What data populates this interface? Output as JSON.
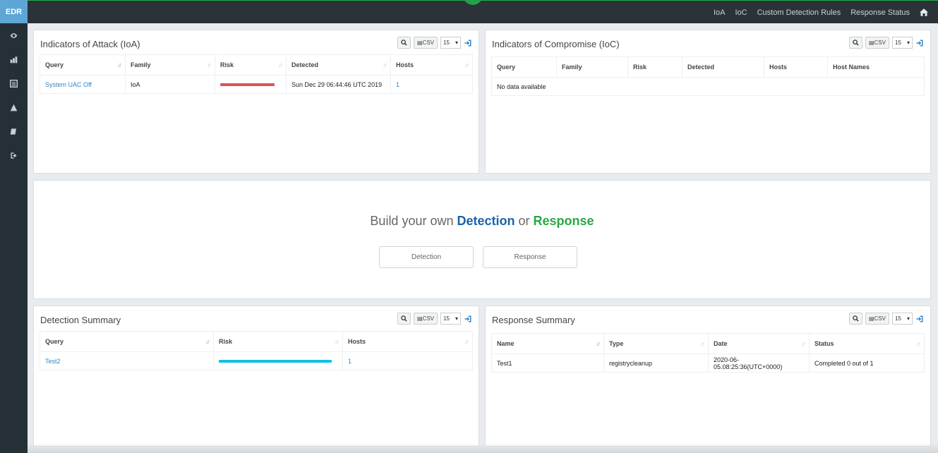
{
  "app": {
    "logo": "EDR"
  },
  "sidebar": {
    "icons": [
      "eye-icon",
      "dashboard-icon",
      "list-icon",
      "alert-icon",
      "book-icon",
      "signout-icon"
    ]
  },
  "topnav": {
    "items": [
      "IoA",
      "IoC",
      "Custom Detection Rules",
      "Response Status"
    ]
  },
  "toolbar": {
    "csv_label": "CSV",
    "page_size": "15"
  },
  "ioa": {
    "title": "Indicators of Attack (IoA)",
    "columns": [
      "Query",
      "Family",
      "Risk",
      "Detected",
      "Hosts"
    ],
    "rows": [
      {
        "query": "System UAC Off",
        "family": "IoA",
        "risk_fraction": 0.9,
        "risk_color": "#d9534f",
        "detected": "Sun Dec 29 06:44:46 UTC 2019",
        "hosts": "1"
      }
    ]
  },
  "ioc": {
    "title": "Indicators of Compromise (IoC)",
    "columns": [
      "Query",
      "Family",
      "Risk",
      "Detected",
      "Hosts",
      "Host Names"
    ],
    "empty": "No data available"
  },
  "builder": {
    "prefix": "Build your own ",
    "detection": "Detection",
    "or": " or ",
    "response": "Response",
    "detection_button": "Detection",
    "response_button": "Response"
  },
  "detection_summary": {
    "title": "Detection Summary",
    "columns": [
      "Query",
      "Risk",
      "Hosts"
    ],
    "rows": [
      {
        "query": "Test2",
        "risk_fraction": 0.95,
        "risk_color": "#12bfe6",
        "hosts": "1"
      }
    ]
  },
  "response_summary": {
    "title": "Response Summary",
    "columns": [
      "Name",
      "Type",
      "Date",
      "Status"
    ],
    "rows": [
      {
        "name": "Test1",
        "type": "registrycleanup",
        "date": "2020-06-05.08:25:36(UTC+0000)",
        "status": "Completed 0 out of 1"
      }
    ]
  }
}
